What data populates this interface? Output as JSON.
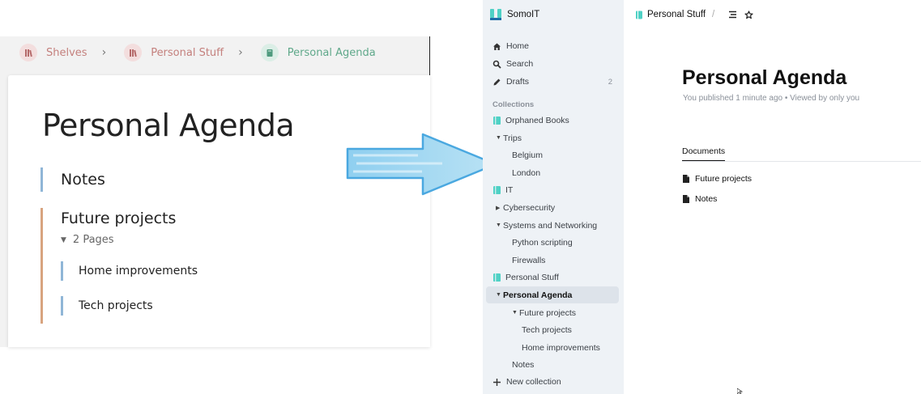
{
  "bookstack": {
    "breadcrumbs": [
      {
        "label": "Shelves",
        "type": "shelf"
      },
      {
        "label": "Personal Stuff",
        "type": "shelf"
      },
      {
        "label": "Personal Agenda",
        "type": "book"
      }
    ],
    "book_title": "Personal Agenda",
    "chapters": [
      {
        "title": "Notes"
      },
      {
        "title": "Future projects",
        "pages_toggle": "2 Pages",
        "pages": [
          "Home improvements",
          "Tech projects"
        ]
      }
    ],
    "colors": {
      "shelf": "#c4807d",
      "book": "#5fa88a",
      "page_border": "#90b6d7",
      "chapter_border": "#d8a47f"
    }
  },
  "outline": {
    "team_name": "SomoIT",
    "nav": [
      {
        "label": "Home",
        "icon": "home-icon"
      },
      {
        "label": "Search",
        "icon": "search-icon"
      },
      {
        "label": "Drafts",
        "icon": "pencil-icon",
        "count": "2"
      }
    ],
    "section_label": "Collections",
    "tree": [
      {
        "label": "Orphaned Books",
        "level": 0,
        "collection": true
      },
      {
        "label": "Trips",
        "level": 1,
        "toggle": "open"
      },
      {
        "label": "Belgium",
        "level": 2
      },
      {
        "label": "London",
        "level": 2
      },
      {
        "label": "IT",
        "level": 0,
        "collection": true
      },
      {
        "label": "Cybersecurity",
        "level": 1,
        "toggle": "closed"
      },
      {
        "label": "Systems and Networking",
        "level": 1,
        "toggle": "open"
      },
      {
        "label": "Python scripting",
        "level": 2
      },
      {
        "label": "Firewalls",
        "level": 2
      },
      {
        "label": "Personal Stuff",
        "level": 0,
        "collection": true
      },
      {
        "label": "Personal Agenda",
        "level": 1,
        "toggle": "open",
        "active": true
      },
      {
        "label": "Future projects",
        "level": 2,
        "toggle": "open"
      },
      {
        "label": "Tech projects",
        "level": 3
      },
      {
        "label": "Home improvements",
        "level": 3
      },
      {
        "label": "Notes",
        "level": 2
      }
    ],
    "new_collection": "New collection",
    "breadcrumb": "Personal Stuff",
    "doc_title": "Personal Agenda",
    "doc_meta_published": "You published 1 minute ago",
    "doc_meta_viewed": "Viewed by only you",
    "tab_label": "Documents",
    "documents": [
      "Future projects",
      "Notes"
    ],
    "colors": {
      "collection": "#4fd1c5",
      "sidebar_bg": "#eef2f6",
      "active_bg": "#dde3ea"
    }
  }
}
